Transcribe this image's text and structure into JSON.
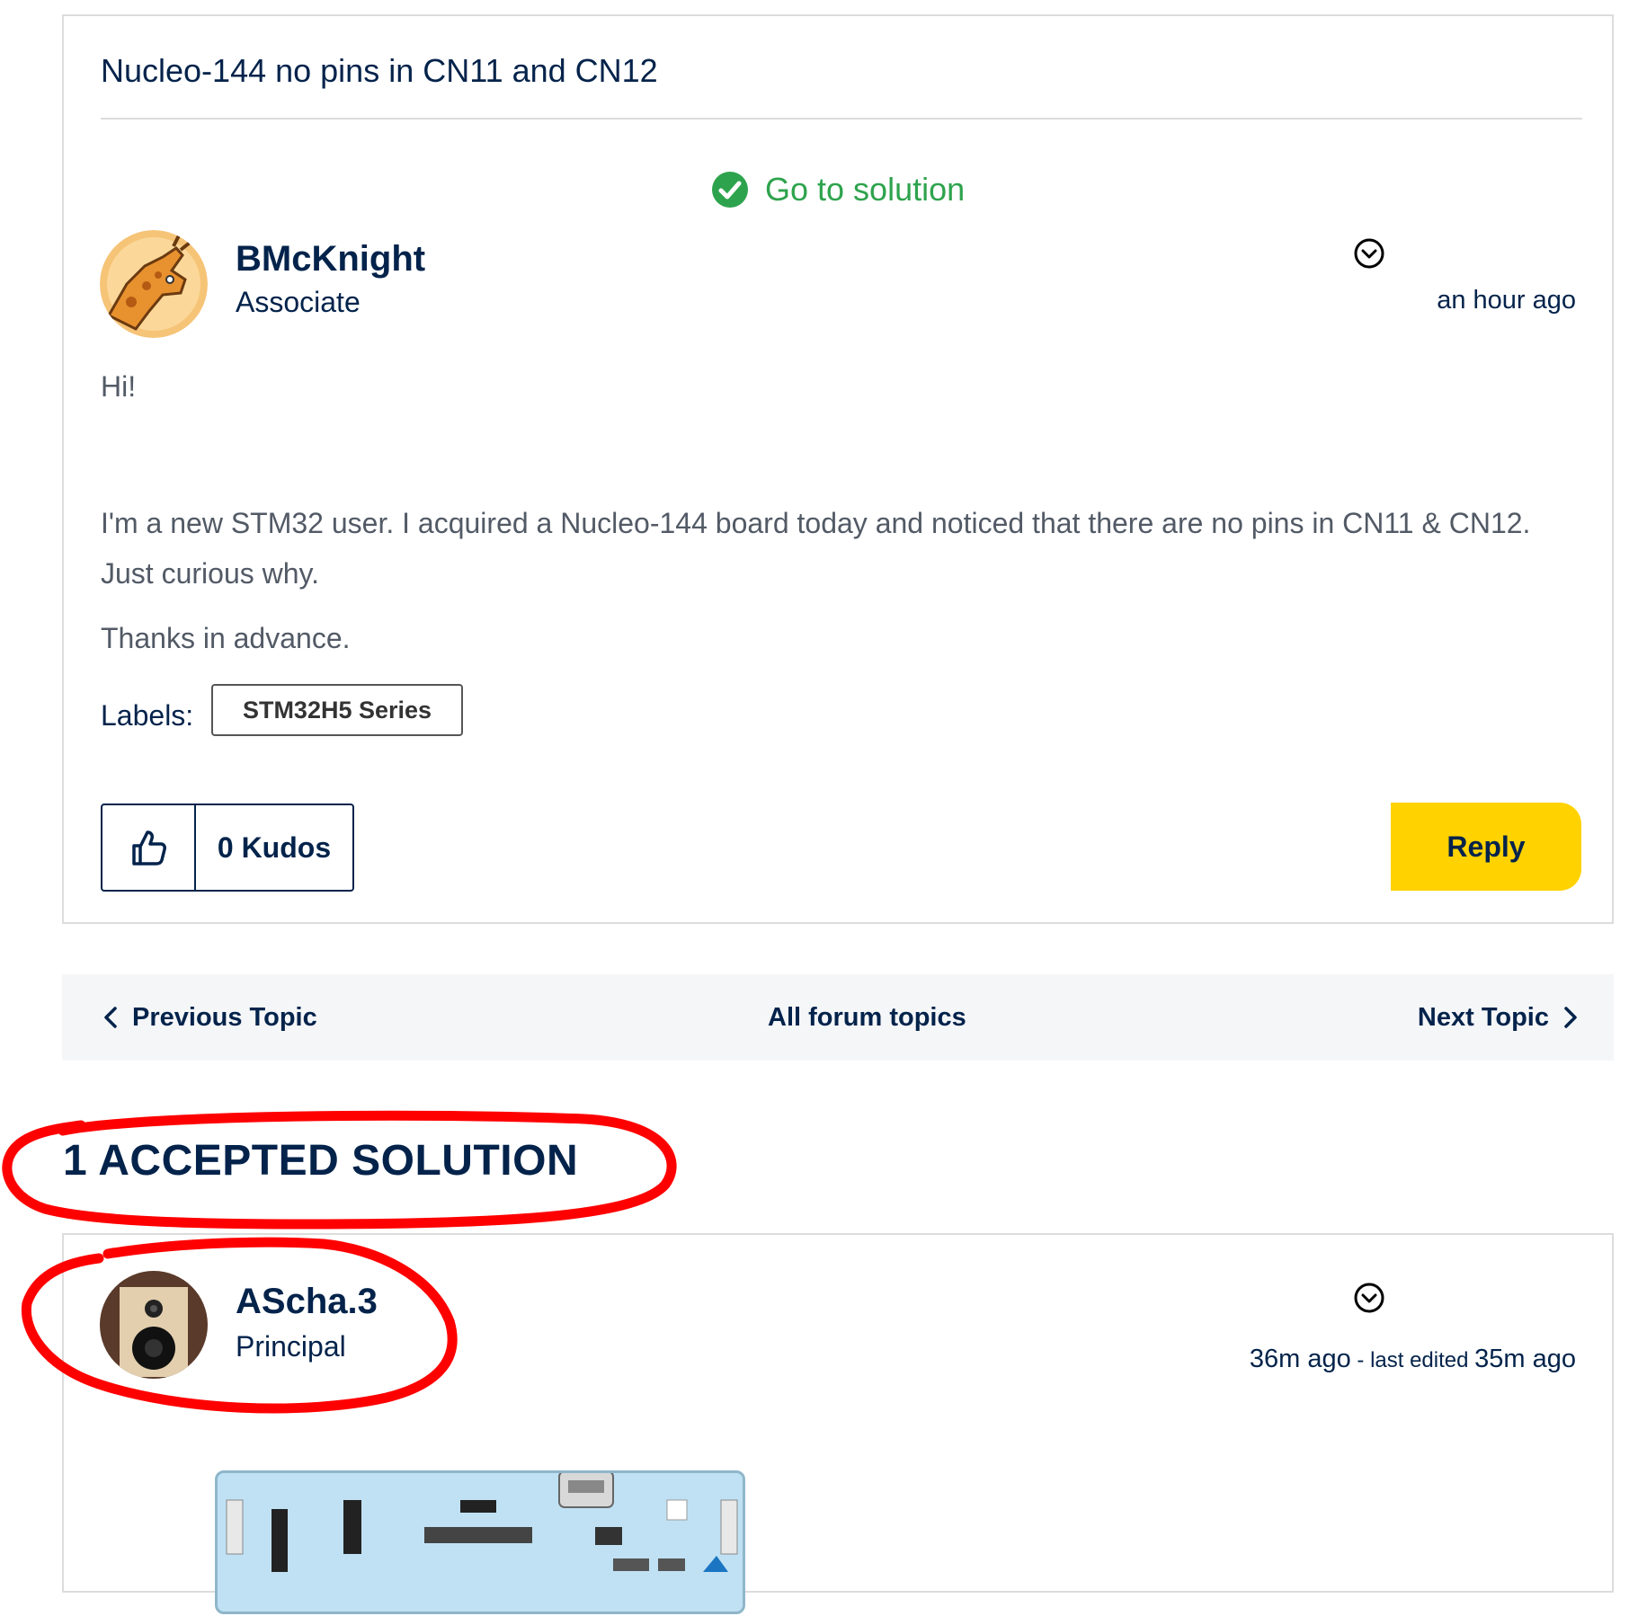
{
  "topic": {
    "title": "Nucleo-144 no pins in CN11 and CN12",
    "go_to_solution": "Go to solution"
  },
  "post": {
    "author": "BMcKnight",
    "rank": "Associate",
    "time": "an hour ago",
    "body": [
      "Hi!",
      "I'm a new STM32 user.  I acquired a Nucleo-144 board today and noticed that there are no pins in CN11 & CN12.",
      "Just curious why.",
      "Thanks in advance."
    ],
    "labels_label": "Labels:",
    "labels": [
      "STM32H5 Series"
    ],
    "kudos": "0 Kudos",
    "reply": "Reply"
  },
  "nav": {
    "previous": "Previous Topic",
    "all": "All forum topics",
    "next": "Next Topic"
  },
  "accepted": {
    "heading": "1 ACCEPTED SOLUTION",
    "author": "AScha.3",
    "rank": "Principal",
    "time": "36m ago",
    "edited_label": " - last edited ",
    "edited_time": "35m ago"
  },
  "colors": {
    "brand_navy": "#03234b",
    "solution_green": "#2ea34d",
    "reply_yellow": "#ffd200",
    "annotation_red": "#ff0000"
  },
  "icons": {
    "check": "check-circle-icon",
    "menu": "chevron-down-circle-icon",
    "thumb": "thumbs-up-icon",
    "prev": "chevron-left-icon",
    "next": "chevron-right-icon"
  }
}
